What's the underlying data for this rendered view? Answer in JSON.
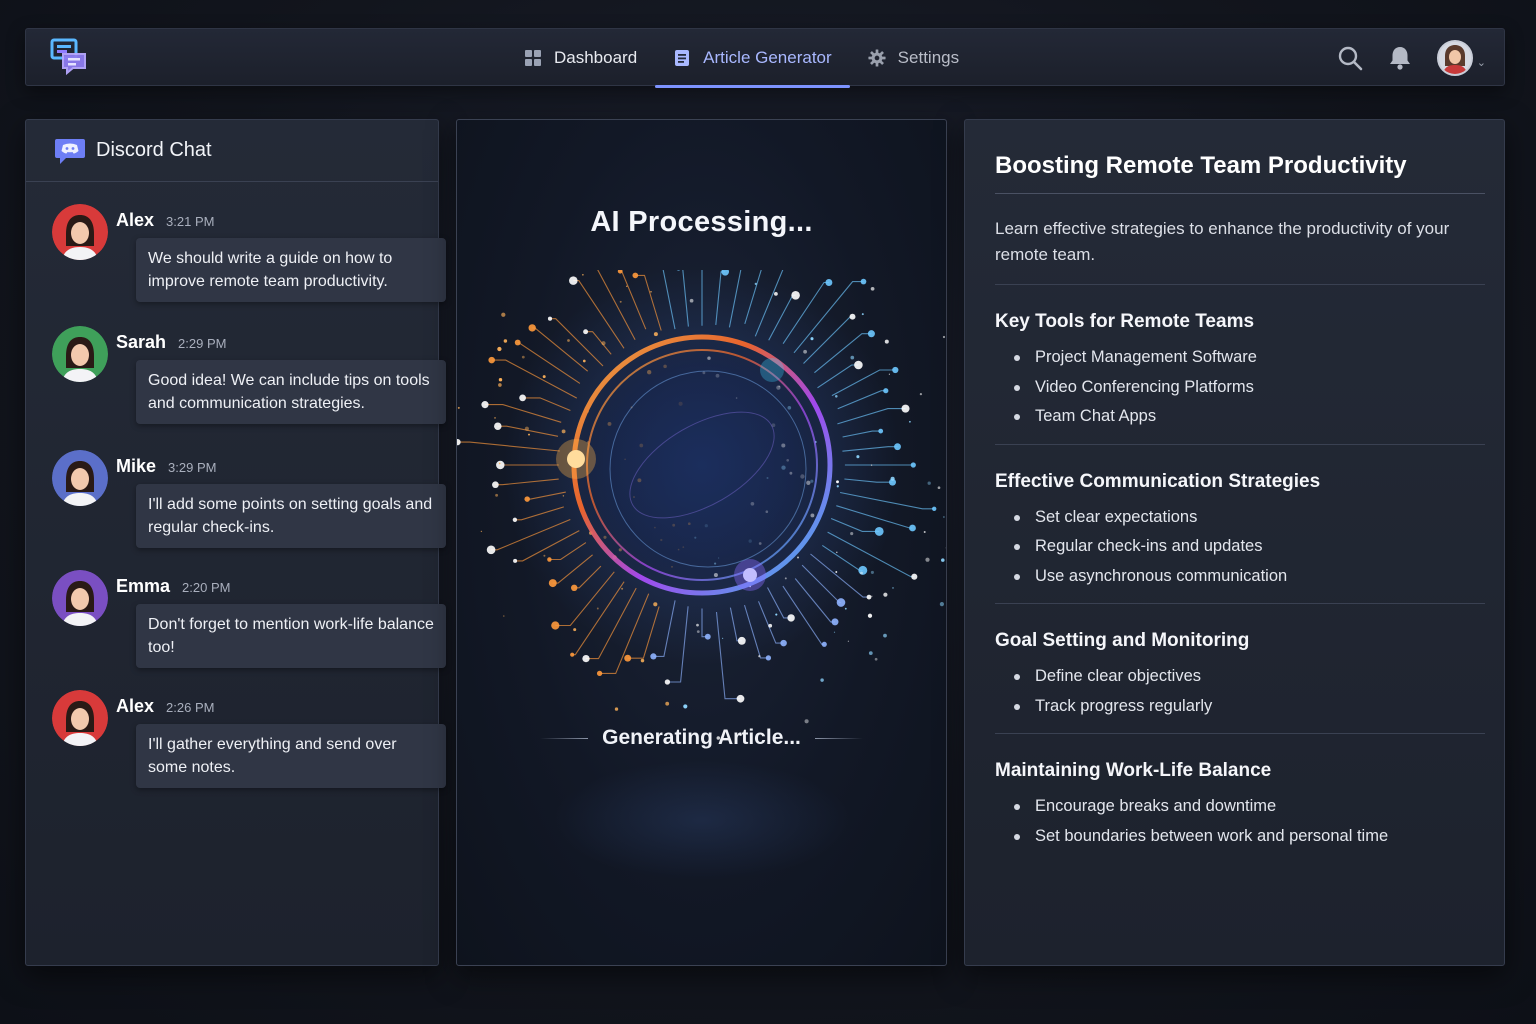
{
  "topbar": {
    "nav": [
      {
        "label": "Dashboard",
        "icon": "grid-icon"
      },
      {
        "label": "Article Generator",
        "icon": "document-icon",
        "active": true
      },
      {
        "label": "Settings",
        "icon": "gear-icon"
      }
    ],
    "accent": "#7d93ff"
  },
  "chat": {
    "title": "Discord Chat",
    "messages": [
      {
        "name": "Alex",
        "time": "3:21 PM",
        "text": "We should write a guide on how to improve remote team productivity.",
        "avatar_color": "#d83a3a"
      },
      {
        "name": "Sarah",
        "time": "2:29 PM",
        "text": "Good idea! We can include tips on tools and communication strategies.",
        "avatar_color": "#3fa05a"
      },
      {
        "name": "Mike",
        "time": "3:29 PM",
        "text": "I'll add some points on setting goals and regular check-ins.",
        "avatar_color": "#5b6fc9"
      },
      {
        "name": "Emma",
        "time": "2:20 PM",
        "text": "Don't forget to mention work-life balance too!",
        "avatar_color": "#7a4fc2"
      },
      {
        "name": "Alex",
        "time": "2:26 PM",
        "text": "I'll gather everything and send over some notes.",
        "avatar_color": "#d83a3a"
      }
    ]
  },
  "processing": {
    "title": "AI Processing...",
    "status": "Generating Article..."
  },
  "article": {
    "title": "Boosting Remote Team Productivity",
    "intro": "Learn effective strategies to enhance the productivity of your remote team.",
    "sections": [
      {
        "heading": "Key Tools for Remote Teams",
        "items": [
          "Project Management Software",
          "Video Conferencing Platforms",
          "Team Chat Apps"
        ]
      },
      {
        "heading": "Effective Communication Strategies",
        "items": [
          "Set clear expectations",
          "Regular check-ins and updates",
          "Use asynchronous communication"
        ]
      },
      {
        "heading": "Goal Setting and Monitoring",
        "items": [
          "Define clear objectives",
          "Track progress regularly"
        ]
      },
      {
        "heading": "Maintaining Work-Life Balance",
        "items": [
          "Encourage breaks and downtime",
          "Set boundaries between work and personal time"
        ]
      }
    ]
  }
}
